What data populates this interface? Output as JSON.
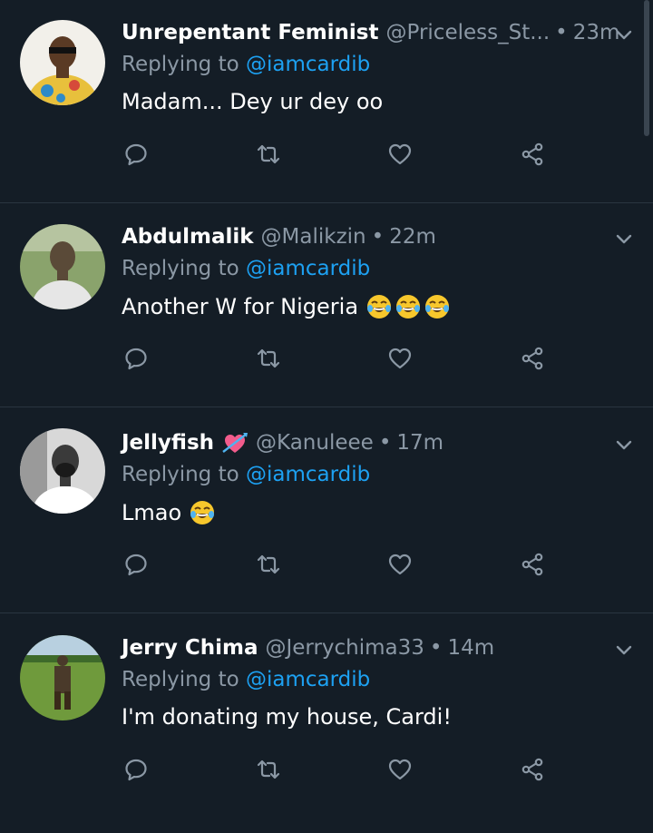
{
  "replying_label": "Replying to",
  "tweets": [
    {
      "name": "Unrepentant Feminist",
      "handle": "@Priceless_St...",
      "separator": "•",
      "time": "23m",
      "reply_to": "@iamcardib",
      "text": "Madam... Dey ur dey oo",
      "emoji_count": 0,
      "name_emoji": "",
      "avatar_colors": [
        "#f2f0ea",
        "#e8c03c",
        "#2e8ac8"
      ]
    },
    {
      "name": "Abdulmalik",
      "handle": "@Malikzin",
      "separator": "•",
      "time": "22m",
      "reply_to": "@iamcardib",
      "text": "Another W for Nigeria",
      "emoji_count": 3,
      "name_emoji": "",
      "avatar_colors": [
        "#8aa36c",
        "#5a4a38",
        "#e6e6e6"
      ]
    },
    {
      "name": "Jellyfish",
      "handle": "@Kanuleee",
      "separator": "•",
      "time": "17m",
      "reply_to": "@iamcardib",
      "text": "Lmao",
      "emoji_count": 1,
      "name_emoji": "heart-with-arrow",
      "avatar_colors": [
        "#d8d8d8",
        "#3a3a3a",
        "#ffffff"
      ]
    },
    {
      "name": "Jerry Chima",
      "handle": "@Jerrychima33",
      "separator": "•",
      "time": "14m",
      "reply_to": "@iamcardib",
      "text": "I'm donating my house, Cardi!",
      "emoji_count": 0,
      "name_emoji": "",
      "avatar_colors": [
        "#6f9a3c",
        "#4a3a2a",
        "#b8d0e0"
      ]
    }
  ],
  "icons": [
    "reply-icon",
    "retweet-icon",
    "like-icon",
    "share-icon",
    "chevron-down-icon"
  ],
  "colors": {
    "background": "#141d26",
    "secondary_text": "#8b98a5",
    "mention": "#1da1f2",
    "divider": "#2a3540"
  }
}
